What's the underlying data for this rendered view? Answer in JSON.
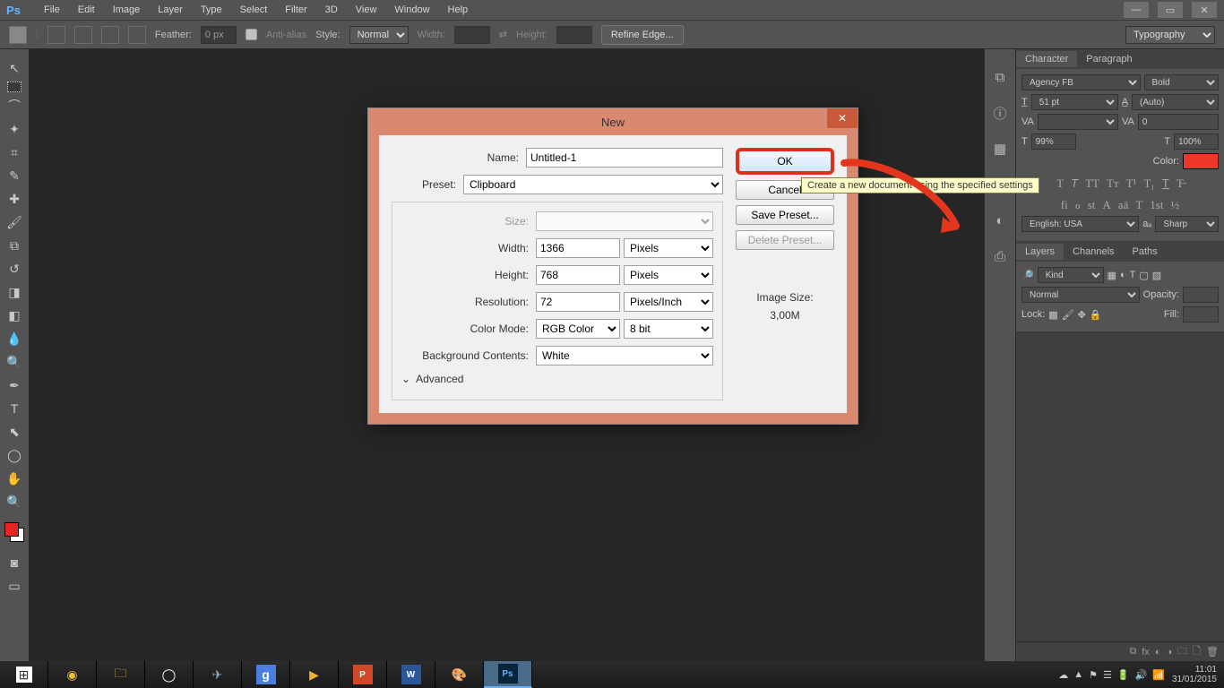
{
  "app": {
    "logo": "Ps"
  },
  "menu": [
    "File",
    "Edit",
    "Image",
    "Layer",
    "Type",
    "Select",
    "Filter",
    "3D",
    "View",
    "Window",
    "Help"
  ],
  "options": {
    "feather_label": "Feather:",
    "feather_value": "0 px",
    "antialias": "Anti-alias",
    "style_label": "Style:",
    "style_value": "Normal",
    "width_label": "Width:",
    "height_label": "Height:",
    "refine": "Refine Edge...",
    "workspace": "Typography"
  },
  "dialog": {
    "title": "New",
    "name_label": "Name:",
    "name_value": "Untitled-1",
    "preset_label": "Preset:",
    "preset_value": "Clipboard",
    "size_label": "Size:",
    "width_label": "Width:",
    "width_value": "1366",
    "width_unit": "Pixels",
    "height_label": "Height:",
    "height_value": "768",
    "height_unit": "Pixels",
    "resolution_label": "Resolution:",
    "resolution_value": "72",
    "resolution_unit": "Pixels/Inch",
    "colormode_label": "Color Mode:",
    "colormode_value": "RGB Color",
    "colordepth_value": "8 bit",
    "bg_label": "Background Contents:",
    "bg_value": "White",
    "advanced": "Advanced",
    "ok": "OK",
    "cancel": "Cancel",
    "save_preset": "Save Preset...",
    "delete_preset": "Delete Preset...",
    "image_size_label": "Image Size:",
    "image_size_value": "3,00M"
  },
  "tooltip": "Create a new document using the specified settings",
  "character_panel": {
    "tab1": "Character",
    "tab2": "Paragraph",
    "font": "Agency FB",
    "style": "Bold",
    "size": "51 pt",
    "leading": "(Auto)",
    "scale_v": "99%",
    "scale_h": "100%",
    "color_label": "Color:",
    "lang": "English: USA",
    "sharp": "Sharp"
  },
  "layers_panel": {
    "tab1": "Layers",
    "tab2": "Channels",
    "tab3": "Paths",
    "kind": "Kind",
    "blend": "Normal",
    "opacity_label": "Opacity:",
    "lock_label": "Lock:",
    "fill_label": "Fill:"
  },
  "tray": {
    "time": "11:01",
    "date": "31/01/2015"
  }
}
